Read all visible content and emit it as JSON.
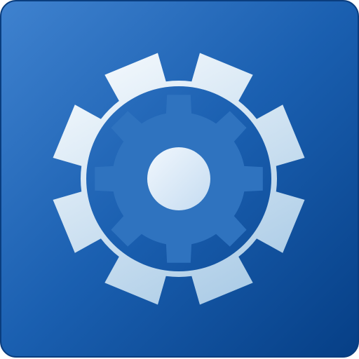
{
  "icon": {
    "name": "settings-gear-icon",
    "colors": {
      "tile_top_left": "#3f82cf",
      "tile_mid": "#1a5fb0",
      "tile_bottom_right": "#063f86",
      "tile_border": "#0a3d7e",
      "outer_gear_light": "#f4f9fd",
      "outer_gear_shadow": "#aacbe6",
      "inner_gear": "#2f73bf",
      "hub_light": "#f1f7fd",
      "hub_shadow": "#c5dcf1"
    }
  }
}
